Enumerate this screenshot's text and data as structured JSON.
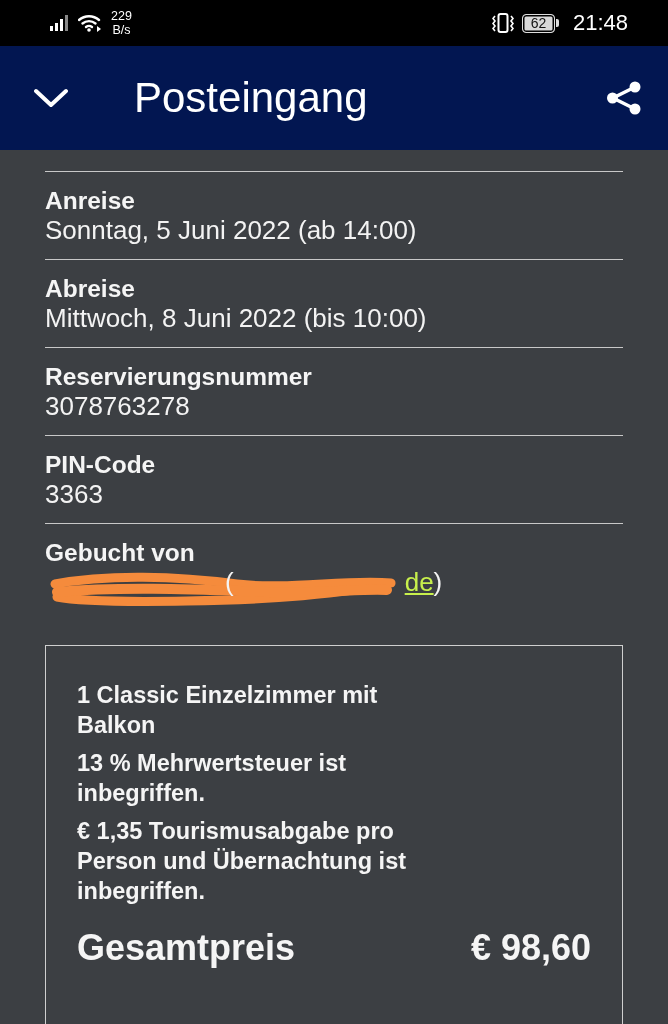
{
  "status_bar": {
    "network_speed": [
      "229",
      "B/s"
    ],
    "battery": "62",
    "time": "21:48"
  },
  "header": {
    "title": "Posteingang"
  },
  "details": [
    {
      "label": "Anreise",
      "value": "Sonntag, 5 Juni 2022 (ab 14:00)"
    },
    {
      "label": "Abreise",
      "value": "Mittwoch, 8 Juni 2022 (bis 10:00)"
    },
    {
      "label": "Reservierungsnummer",
      "value": "3078763278"
    },
    {
      "label": "PIN-Code",
      "value": "3363"
    }
  ],
  "booked_by": {
    "label": "Gebucht von",
    "open_paren": "(",
    "email_tail": "de",
    "close_paren": ")"
  },
  "price_box": {
    "lines": [
      "1 Classic Einzelzimmer mit Balkon",
      "13 % Mehrwertsteuer ist inbegriffen.",
      "€ 1,35 Tourismusabgabe pro Person und Übernachtung ist inbegriffen."
    ],
    "total_label": "Gesamtpreis",
    "total_value": "€ 98,60"
  }
}
